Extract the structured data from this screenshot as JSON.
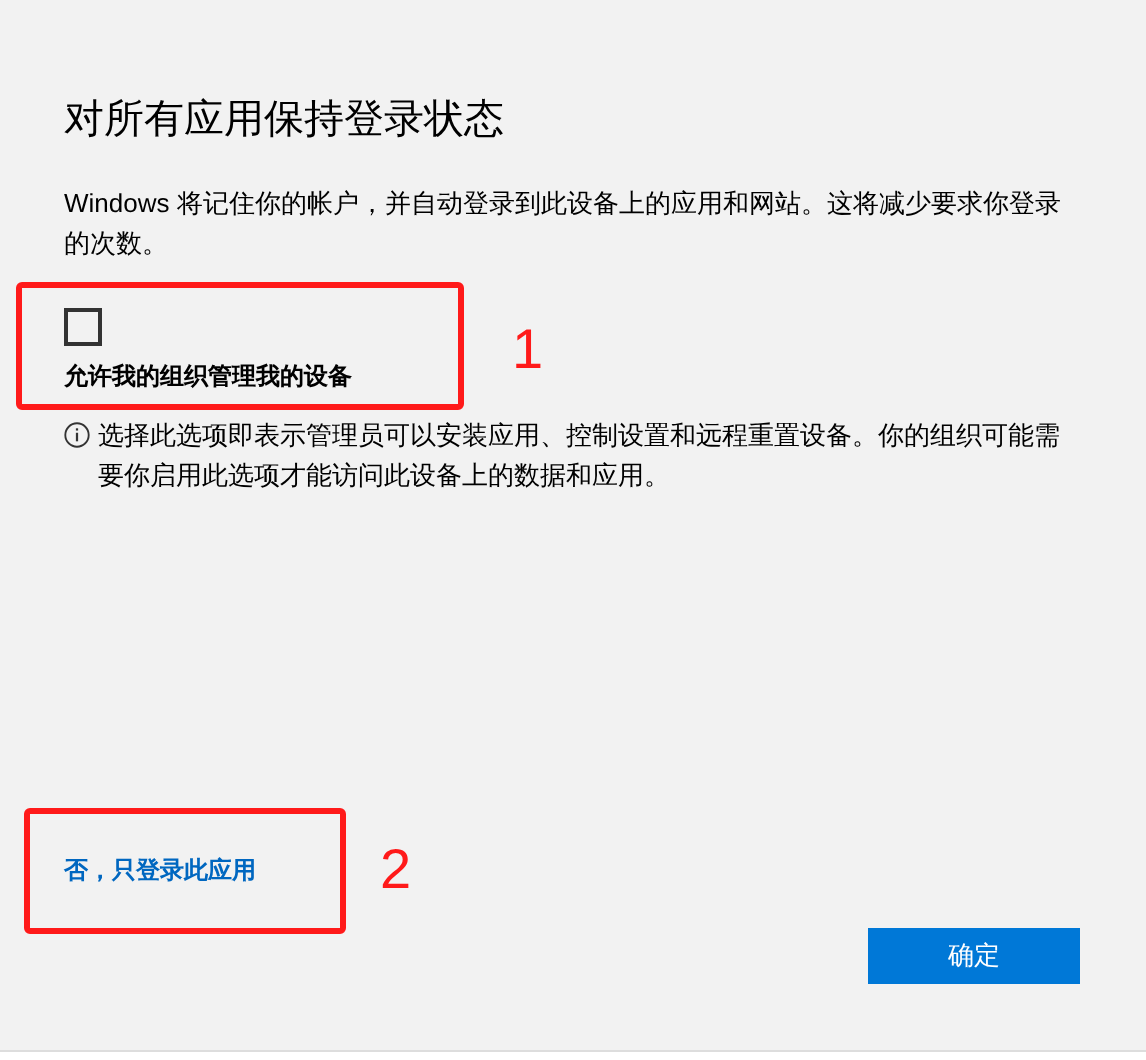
{
  "title": "对所有应用保持登录状态",
  "description": "Windows 将记住你的帐户，并自动登录到此设备上的应用和网站。这将减少要求你登录的次数。",
  "checkbox": {
    "label": "允许我的组织管理我的设备",
    "checked": false
  },
  "info": "选择此选项即表示管理员可以安装应用、控制设置和远程重置设备。你的组织可能需要你启用此选项才能访问此设备上的数据和应用。",
  "link": "否，只登录此应用",
  "buttons": [
    "确定"
  ],
  "annotations": [
    {
      "label": "1"
    },
    {
      "label": "2"
    }
  ]
}
